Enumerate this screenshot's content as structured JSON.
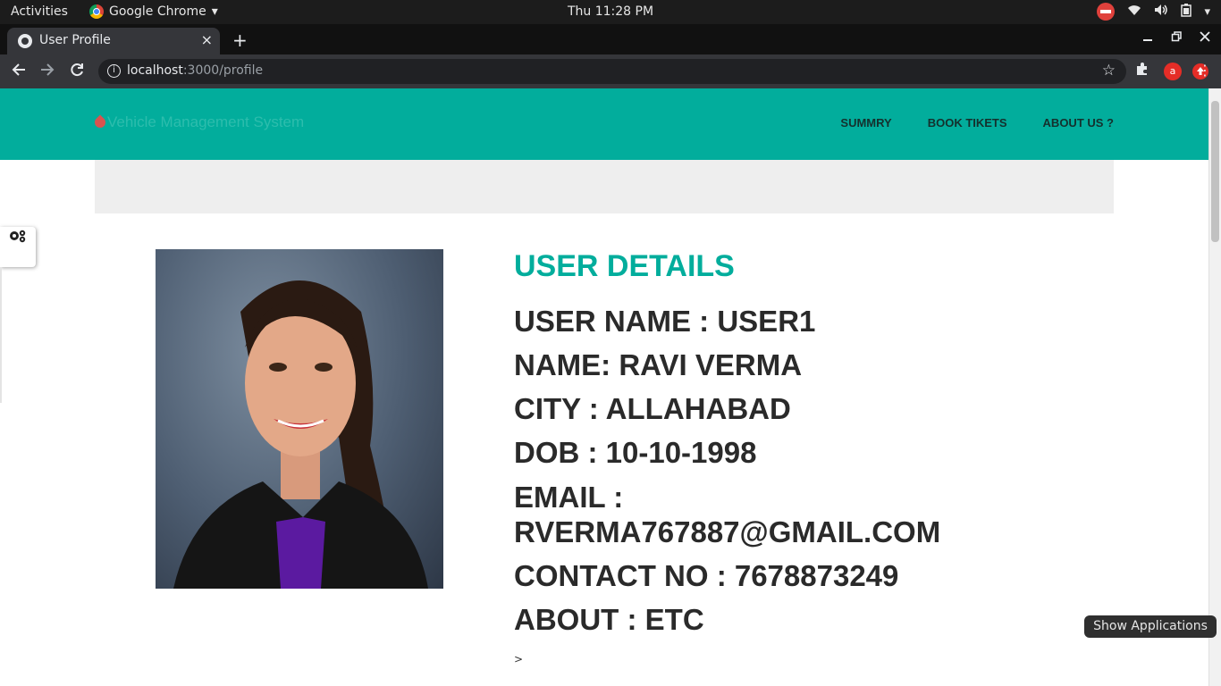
{
  "system_bar": {
    "activities": "Activities",
    "app_name": "Google Chrome",
    "app_caret": "▾",
    "clock": "Thu 11:28 PM",
    "tray_caret": "▾"
  },
  "browser": {
    "tab_title": "User Profile",
    "tab_close": "×",
    "new_tab": "+",
    "url_host": "localhost",
    "url_rest": ":3000/profile",
    "extension_badge": "a"
  },
  "site": {
    "brand": "Vehicle Management System",
    "nav": [
      "SUMMRY",
      "BOOK TIKETS",
      "ABOUT US ?"
    ]
  },
  "profile": {
    "heading": "USER DETAILS",
    "rows": [
      "USER NAME : USER1",
      "NAME: RAVI VERMA",
      "CITY : ALLAHABAD",
      "DOB : 10-10-1998",
      "EMAIL : RVERMA767887@GMAIL.COM",
      "CONTACT NO : 7678873249",
      "ABOUT : ETC"
    ],
    "trailing": ">"
  },
  "tooltip": "Show Applications"
}
